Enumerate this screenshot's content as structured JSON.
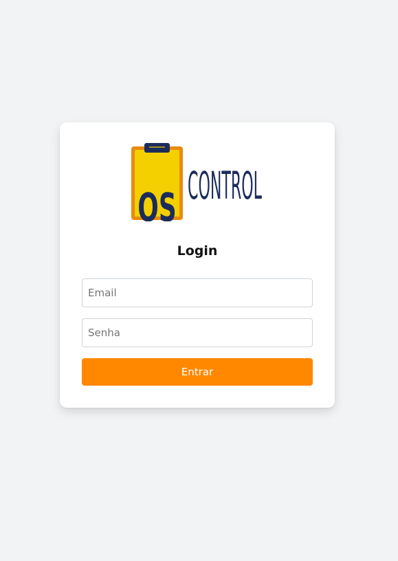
{
  "logo": {
    "badge_text": "OS",
    "word_text": "CONTROL",
    "colors": {
      "clipboard_border": "#e88a10",
      "clipboard_fill": "#f4d000",
      "navy": "#1c2c5a"
    }
  },
  "login": {
    "title": "Login",
    "email_placeholder": "Email",
    "password_placeholder": "Senha",
    "submit_label": "Entrar"
  },
  "theme": {
    "background": "#f2f3f5",
    "card": "#ffffff",
    "accent": "#ff8800"
  }
}
